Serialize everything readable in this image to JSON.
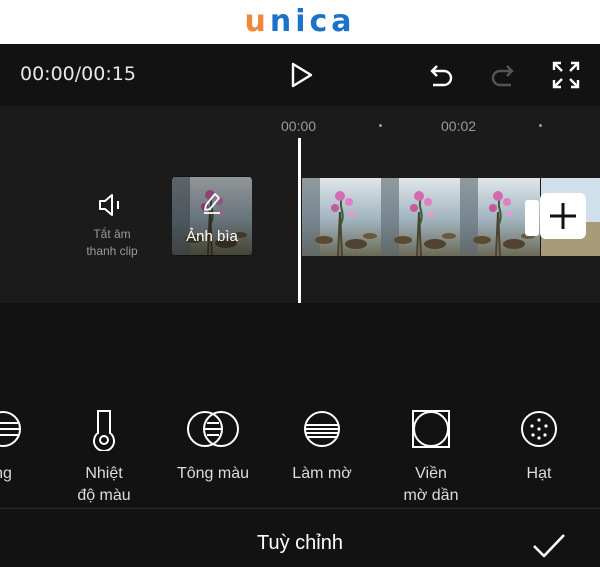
{
  "brand": {
    "letter_u": "u",
    "rest": "nica"
  },
  "playback": {
    "time": "00:00/00:15"
  },
  "controls": {
    "play_icon": "play-icon",
    "undo_icon": "undo-icon",
    "redo_icon": "redo-icon",
    "fullscreen_icon": "fullscreen-icon"
  },
  "timeline": {
    "ticks": [
      "00:00",
      "00:02"
    ],
    "mute": {
      "line1": "Tắt âm",
      "line2": "thanh clip"
    },
    "cover_label": "Ảnh bìa"
  },
  "tools": [
    {
      "icon": "partial-circle-icon",
      "line1": "ng",
      "line2": ""
    },
    {
      "icon": "thermometer-icon",
      "line1": "Nhiệt",
      "line2": "độ màu"
    },
    {
      "icon": "overlapping-circles-icon",
      "line1": "Tông màu",
      "line2": ""
    },
    {
      "icon": "blur-circle-icon",
      "line1": "Làm mờ",
      "line2": ""
    },
    {
      "icon": "vignette-icon",
      "line1": "Viền",
      "line2": "mờ dần"
    },
    {
      "icon": "grain-icon",
      "line1": "Hạt",
      "line2": ""
    }
  ],
  "footer": {
    "title": "Tuỳ chỉnh",
    "confirm_icon": "check-icon"
  },
  "colors": {
    "logo_u": "#f0883a",
    "logo_text": "#1b72c9",
    "background": "#121212",
    "timeline_bg": "#1b1b1b"
  }
}
